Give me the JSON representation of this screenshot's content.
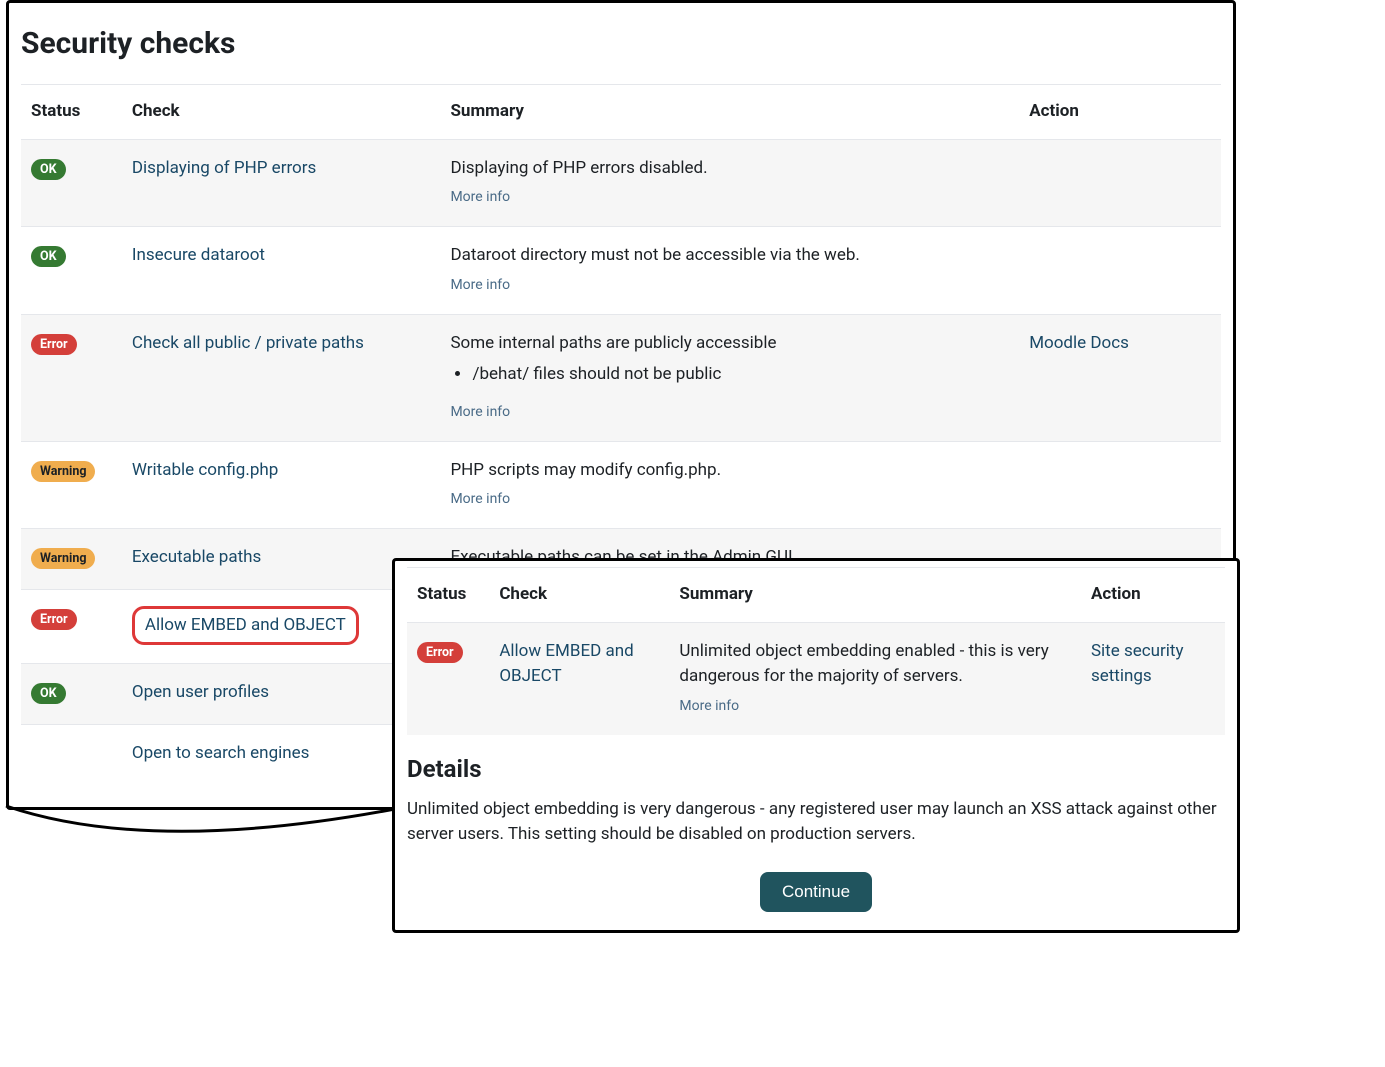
{
  "page": {
    "title": "Security checks"
  },
  "main_table": {
    "headers": {
      "status": "Status",
      "check": "Check",
      "summary": "Summary",
      "action": "Action"
    },
    "more_info_label": "More info",
    "rows": [
      {
        "status": {
          "label": "OK",
          "kind": "ok"
        },
        "check": "Displaying of PHP errors",
        "summary": "Displaying of PHP errors disabled.",
        "action": ""
      },
      {
        "status": {
          "label": "OK",
          "kind": "ok"
        },
        "check": "Insecure dataroot",
        "summary": "Dataroot directory must not be accessible via the web.",
        "action": ""
      },
      {
        "status": {
          "label": "Error",
          "kind": "error"
        },
        "check": "Check all public / private paths",
        "summary": "Some internal paths are publicly accessible",
        "bullets": [
          "/behat/ files should not be public"
        ],
        "action": "Moodle Docs"
      },
      {
        "status": {
          "label": "Warning",
          "kind": "warning"
        },
        "check": "Writable config.php",
        "summary": "PHP scripts may modify config.php.",
        "action": ""
      },
      {
        "status": {
          "label": "Warning",
          "kind": "warning"
        },
        "check": "Executable paths",
        "summary": "Executable paths can be set in the Admin GUI.",
        "action": ""
      },
      {
        "status": {
          "label": "Error",
          "kind": "error"
        },
        "check": "Allow EMBED and OBJECT",
        "highlighted": true,
        "summary": "",
        "action": ""
      },
      {
        "status": {
          "label": "OK",
          "kind": "ok"
        },
        "check": "Open user profiles",
        "summary": "",
        "action": ""
      },
      {
        "status": {
          "label": "",
          "kind": ""
        },
        "check": "Open to search engines",
        "summary": "",
        "action": ""
      }
    ]
  },
  "detail_table": {
    "headers": {
      "status": "Status",
      "check": "Check",
      "summary": "Summary",
      "action": "Action"
    },
    "more_info_label": "More info",
    "row": {
      "status": {
        "label": "Error",
        "kind": "error"
      },
      "check": "Allow EMBED and OBJECT",
      "summary": "Unlimited object embedding enabled - this is very dangerous for the majority of servers.",
      "action": "Site security settings"
    }
  },
  "details": {
    "heading": "Details",
    "body": "Unlimited object embedding is very dangerous - any registered user may launch an XSS attack against other server users. This setting should be disabled on production servers.",
    "continue_label": "Continue"
  },
  "colors": {
    "ok": "#357a32",
    "error": "#d43f3a",
    "warning": "#f0ad4e",
    "link": "#0f6cbf",
    "button": "#20545e"
  }
}
